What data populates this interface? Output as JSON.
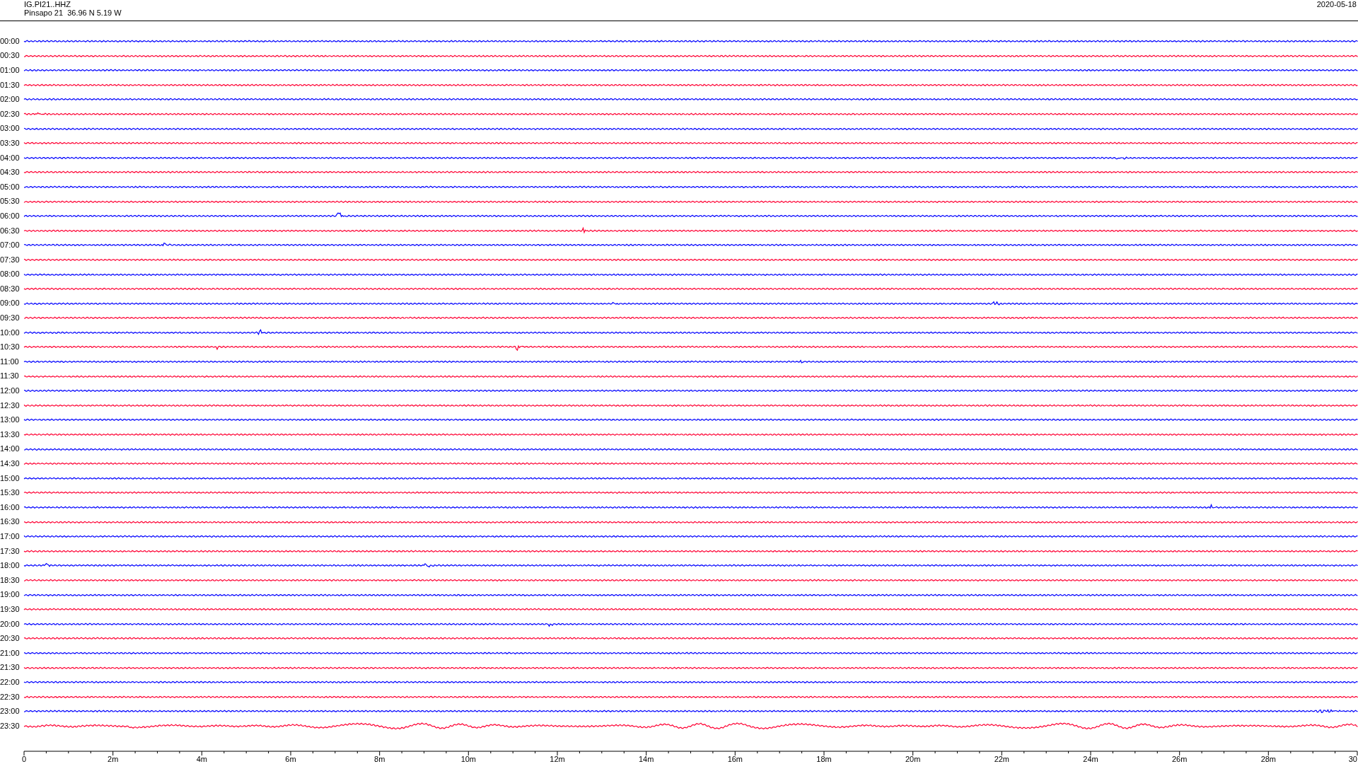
{
  "header": {
    "station_code": "IG.PI21..HHZ",
    "station_location": "Pinsapo 21  36.96 N 5.19 W",
    "date": "2020-05-18"
  },
  "rows": [
    {
      "label": "00:00",
      "color": "#0000ff"
    },
    {
      "label": "00:30",
      "color": "#ff0033"
    },
    {
      "label": "01:00",
      "color": "#0000ff"
    },
    {
      "label": "01:30",
      "color": "#ff0033"
    },
    {
      "label": "02:00",
      "color": "#0000ff"
    },
    {
      "label": "02:30",
      "color": "#ff0033"
    },
    {
      "label": "03:00",
      "color": "#0000ff"
    },
    {
      "label": "03:30",
      "color": "#ff0033"
    },
    {
      "label": "04:00",
      "color": "#0000ff"
    },
    {
      "label": "04:30",
      "color": "#ff0033"
    },
    {
      "label": "05:00",
      "color": "#0000ff"
    },
    {
      "label": "05:30",
      "color": "#ff0033"
    },
    {
      "label": "06:00",
      "color": "#0000ff"
    },
    {
      "label": "06:30",
      "color": "#ff0033"
    },
    {
      "label": "07:00",
      "color": "#0000ff"
    },
    {
      "label": "07:30",
      "color": "#ff0033"
    },
    {
      "label": "08:00",
      "color": "#0000ff"
    },
    {
      "label": "08:30",
      "color": "#ff0033"
    },
    {
      "label": "09:00",
      "color": "#0000ff"
    },
    {
      "label": "09:30",
      "color": "#ff0033"
    },
    {
      "label": "10:00",
      "color": "#0000ff"
    },
    {
      "label": "10:30",
      "color": "#ff0033"
    },
    {
      "label": "11:00",
      "color": "#0000ff"
    },
    {
      "label": "11:30",
      "color": "#ff0033"
    },
    {
      "label": "12:00",
      "color": "#0000ff"
    },
    {
      "label": "12:30",
      "color": "#ff0033"
    },
    {
      "label": "13:00",
      "color": "#0000ff"
    },
    {
      "label": "13:30",
      "color": "#ff0033"
    },
    {
      "label": "14:00",
      "color": "#0000ff"
    },
    {
      "label": "14:30",
      "color": "#ff0033"
    },
    {
      "label": "15:00",
      "color": "#0000ff"
    },
    {
      "label": "15:30",
      "color": "#ff0033"
    },
    {
      "label": "16:00",
      "color": "#0000ff"
    },
    {
      "label": "16:30",
      "color": "#ff0033"
    },
    {
      "label": "17:00",
      "color": "#0000ff"
    },
    {
      "label": "17:30",
      "color": "#ff0033"
    },
    {
      "label": "18:00",
      "color": "#0000ff"
    },
    {
      "label": "18:30",
      "color": "#ff0033"
    },
    {
      "label": "19:00",
      "color": "#0000ff"
    },
    {
      "label": "19:30",
      "color": "#ff0033"
    },
    {
      "label": "20:00",
      "color": "#0000ff"
    },
    {
      "label": "20:30",
      "color": "#ff0033"
    },
    {
      "label": "21:00",
      "color": "#0000ff"
    },
    {
      "label": "21:30",
      "color": "#ff0033"
    },
    {
      "label": "22:00",
      "color": "#0000ff"
    },
    {
      "label": "22:30",
      "color": "#ff0033"
    },
    {
      "label": "23:00",
      "color": "#0000ff"
    },
    {
      "label": "23:30",
      "color": "#ff0033"
    }
  ],
  "x_axis": {
    "labels": [
      "0",
      "2m",
      "4m",
      "6m",
      "8m",
      "10m",
      "12m",
      "14m",
      "16m",
      "18m",
      "20m",
      "22m",
      "24m",
      "26m",
      "28m",
      "30"
    ]
  }
}
